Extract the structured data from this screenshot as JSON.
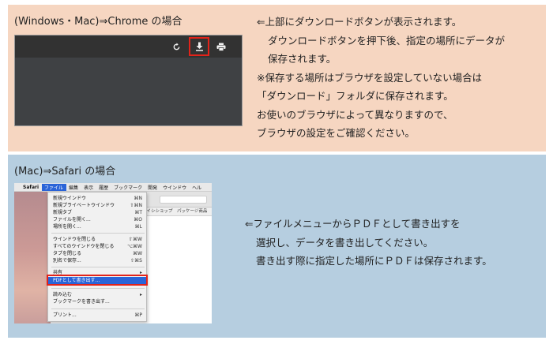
{
  "chrome_section": {
    "title": "(Windows・Mac)⇒Chrome の場合",
    "toolbar_icons": [
      "rotate-icon",
      "download-icon",
      "print-icon"
    ],
    "highlight_color": "#e2231a",
    "description": [
      "⇐上部にダウンロードボタンが表示されます。",
      "ダウンロードボタンを押下後、指定の場所にデータが",
      "保存されます。",
      "※保存する場所はブラウザを設定していない場合は",
      "「ダウンロード」フォルダに保存されます。",
      "お使いのブラウザによって異なりますので、",
      "ブラウザの設定をご確認ください。"
    ]
  },
  "safari_section": {
    "title": "(Mac)⇒Safari の場合",
    "menubar": {
      "apple": "",
      "app": "Safari",
      "items": [
        "ファイル",
        "編集",
        "表示",
        "履歴",
        "ブックマーク",
        "開発",
        "ウインドウ",
        "ヘル"
      ]
    },
    "favorites_bar": "ライシショップ　パッケージ商品　[株式",
    "file_menu": [
      {
        "label": "新規ウインドウ",
        "shortcut": "⌘N"
      },
      {
        "label": "新規プライベートウインドウ",
        "shortcut": "⇧⌘N"
      },
      {
        "label": "新規タブ",
        "shortcut": "⌘T"
      },
      {
        "label": "ファイルを開く...",
        "shortcut": "⌘O"
      },
      {
        "label": "場所を開く...",
        "shortcut": "⌘L"
      },
      {
        "label": "ウインドウを閉じる",
        "shortcut": "⇧⌘W"
      },
      {
        "label": "すべてのウインドウを閉じる",
        "shortcut": "⌥⌘W"
      },
      {
        "label": "タブを閉じる",
        "shortcut": "⌘W"
      },
      {
        "label": "別名で保存...",
        "shortcut": "⇧⌘S"
      },
      {
        "label": "共有",
        "shortcut": "▸"
      },
      {
        "label": "PDFとして書き出す...",
        "shortcut": ""
      },
      {
        "label": "読み込む",
        "shortcut": "▸"
      },
      {
        "label": "ブックマークを書き出す...",
        "shortcut": ""
      },
      {
        "label": "プリント...",
        "shortcut": "⌘P"
      }
    ],
    "description": [
      "⇐ファイルメニューからＰＤＦとして書き出すを",
      "選択し、データを書き出してください。",
      "書き出す際に指定した場所にＰＤＦは保存されます。"
    ]
  }
}
